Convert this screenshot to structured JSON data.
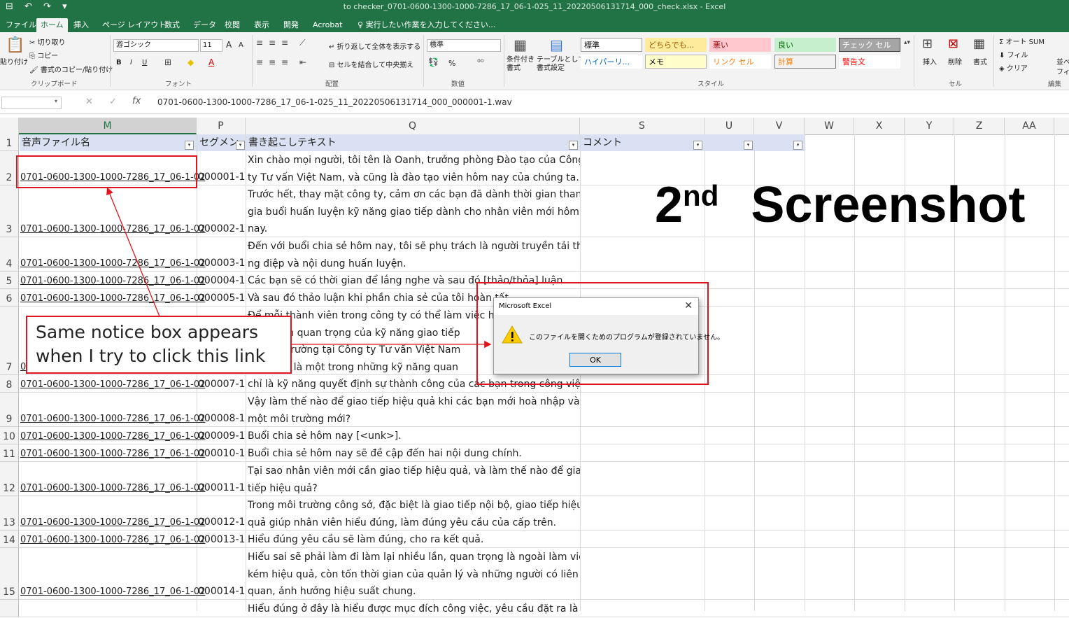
{
  "window": {
    "title": "to checker_0701-0600-1300-1000-7286_17_06-1-025_11_20220506131714_000_check.xlsx - Excel",
    "quick_access": "⊟ ↶ ↷ ▾"
  },
  "menu": {
    "tabs": [
      "ファイル",
      "ホーム",
      "挿入",
      "ページ レイアウト",
      "数式",
      "データ",
      "校閲",
      "表示",
      "開発",
      "Acrobat"
    ],
    "tell_me": "実行したい作業を入力してください..."
  },
  "ribbon": {
    "clipboard": {
      "paste": "貼り付け",
      "cut": "切り取り",
      "copy": "コピー",
      "format_painter": "書式のコピー/貼り付け",
      "label": "クリップボード"
    },
    "font": {
      "name": "游ゴシック",
      "size": "11",
      "label": "フォント",
      "grow": "A",
      "shrink": "A",
      "bold": "B",
      "italic": "I",
      "underline": "U"
    },
    "alignment": {
      "wrap": "折り返して全体を表示する",
      "merge": "セルを結合して中央揃え",
      "label": "配置"
    },
    "number": {
      "format": "標準",
      "label": "数値",
      "percent": "%"
    },
    "styles": {
      "conditional": "条件付き\n書式",
      "table": "テーブルとして\n書式設定",
      "cells": [
        {
          "text": "標準",
          "bg": "#ffffff",
          "fg": "#000000",
          "border": "#9a9a9a"
        },
        {
          "text": "どちらでも...",
          "bg": "#ffeb9c",
          "fg": "#9c5700",
          "border": "#ffeb9c"
        },
        {
          "text": "悪い",
          "bg": "#ffc7ce",
          "fg": "#9c0006",
          "border": "#ffc7ce"
        },
        {
          "text": "良い",
          "bg": "#c6efce",
          "fg": "#006100",
          "border": "#c6efce"
        },
        {
          "text": "チェック セル",
          "bg": "#a5a5a5",
          "fg": "#ffffff",
          "border": "#3f3f3f"
        },
        {
          "text": "ハイパーリ...",
          "bg": "#ffffff",
          "fg": "#0563c1",
          "border": "#ffffff"
        },
        {
          "text": "メモ",
          "bg": "#ffffcc",
          "fg": "#000000",
          "border": "#b2b2b2"
        },
        {
          "text": "リンク セル",
          "bg": "#ffffff",
          "fg": "#fa7d00",
          "border": "#ffffff"
        },
        {
          "text": "計算",
          "bg": "#f2f2f2",
          "fg": "#fa7d00",
          "border": "#7f7f7f"
        },
        {
          "text": "警告文",
          "bg": "#ffffff",
          "fg": "#ff0000",
          "border": "#ffffff"
        }
      ],
      "label": "スタイル"
    },
    "cells": {
      "insert": "挿入",
      "delete": "削除",
      "format": "書式",
      "label": "セル"
    },
    "editing": {
      "autosum": "オート SUM",
      "fill": "フィル",
      "clear": "クリア",
      "sort": "並べ",
      "filter": "フィ",
      "label": "編集"
    }
  },
  "formula_bar": {
    "value": "0701-0600-1300-1000-7286_17_06-1-025_11_20220506131714_000_000001-1.wav"
  },
  "columns": [
    "M",
    "P",
    "Q",
    "S",
    "U",
    "V",
    "W",
    "X",
    "Y",
    "Z",
    "AA"
  ],
  "header_row": {
    "M": "音声ファイル名",
    "P": "セグメン",
    "Q": "書き起こしテキスト",
    "S": "コメント"
  },
  "rows": [
    {
      "num": "2",
      "file": "0701-0600-1300-1000-7286_17_06-1-02",
      "seg": "000001-1",
      "text": [
        "Xin chào mọi người, tôi tên là Oanh, trưởng phòng Đào tạo của Công",
        "ty Tư vấn Việt Nam, và cũng là đào tạo viên hôm nay của chúng ta."
      ]
    },
    {
      "num": "3",
      "file": "0701-0600-1300-1000-7286_17_06-1-02",
      "seg": "000002-1",
      "text": [
        "Trước hết, thay mặt công ty, cảm ơn các bạn đã dành thời gian tham",
        "gia buổi huấn luyện kỹ năng giao tiếp dành cho nhân viên mới hôm",
        "nay."
      ]
    },
    {
      "num": "4",
      "file": "0701-0600-1300-1000-7286_17_06-1-02",
      "seg": "000003-1",
      "text": [
        "Đến với buổi chia sẻ hôm nay, tôi sẽ phụ trách là người truyền tải thô",
        "ng điệp và nội dung huấn luyện."
      ]
    },
    {
      "num": "5",
      "file": "0701-0600-1300-1000-7286_17_06-1-02",
      "seg": "000004-1",
      "text": [
        "Các bạn sẽ có thời gian để lắng nghe và sau đó [thảo/thỏa] luận."
      ]
    },
    {
      "num": "6",
      "file": "0701-0600-1300-1000-7286_17_06-1-02",
      "seg": "000005-1",
      "text": [
        "Và sau đó thảo luận khi phần chia sẻ của tôi hoàn tất."
      ]
    },
    {
      "num": "7",
      "file": "0701-0600-1300-1000-7286_17_06-1-02",
      "seg": "000006-1",
      "text": [
        "Để mỗi thành viên trong công ty có thể làm việc hiệu",
        "được tầm quan trọng của kỹ năng giao tiếp",
        "với môi trường tại Công ty Tư vấn Việt Nam",
        "giao tiếp là một trong những kỹ năng quan"
      ]
    },
    {
      "num": "8",
      "file": "0701-0600-1300-1000-7286_17_06-1-02",
      "seg": "000007-1",
      "text": [
        "chỉ là kỹ năng quyết định sự thành công của các bạn trong công việc."
      ]
    },
    {
      "num": "9",
      "file": "0701-0600-1300-1000-7286_17_06-1-02",
      "seg": "000008-1",
      "text": [
        "Vậy làm thế nào để giao tiếp hiệu quả khi các bạn mới hoà nhập vào",
        "một môi trường mới?"
      ]
    },
    {
      "num": "10",
      "file": "0701-0600-1300-1000-7286_17_06-1-02",
      "seg": "000009-1",
      "text": [
        "Buổi chia sẻ hôm nay [<unk>]."
      ]
    },
    {
      "num": "11",
      "file": "0701-0600-1300-1000-7286_17_06-1-02",
      "seg": "000010-1",
      "text": [
        "Buổi chia sẻ hôm nay sẽ đề cập đến hai nội dung chính."
      ]
    },
    {
      "num": "12",
      "file": "0701-0600-1300-1000-7286_17_06-1-02",
      "seg": "000011-1",
      "text": [
        "Tại sao nhân viên mới cần giao tiếp hiệu quả, và làm thế nào để giao",
        "tiếp hiệu quả?"
      ]
    },
    {
      "num": "13",
      "file": "0701-0600-1300-1000-7286_17_06-1-02",
      "seg": "000012-1",
      "text": [
        "Trong môi trường công sở, đặc biệt là giao tiếp nội bộ, giao tiếp hiệu",
        "quả giúp nhân viên hiểu đúng, làm đúng yêu cầu của cấp trên."
      ]
    },
    {
      "num": "14",
      "file": "0701-0600-1300-1000-7286_17_06-1-02",
      "seg": "000013-1",
      "text": [
        "Hiểu đúng yêu cầu sẽ làm đúng, cho ra kết quả."
      ]
    },
    {
      "num": "15",
      "file": "0701-0600-1300-1000-7286_17_06-1-02",
      "seg": "000014-1",
      "text": [
        "Hiểu sai sẽ phải làm đi làm lại nhiều lần, quan trọng là ngoài làm việc",
        "kém hiệu quả, còn tốn thời gian của quản lý và những người có liên",
        "quan, ảnh hưởng hiệu suất chung."
      ]
    },
    {
      "num": "",
      "file": "",
      "seg": "",
      "text": [
        "Hiểu đúng ở đây là hiểu được mục đích công việc, yêu cầu đặt ra là g"
      ]
    }
  ],
  "annotation": {
    "callout": "Same notice box appears\nwhen I try to click this link",
    "big_title": "2",
    "big_title_sup": "nd",
    "big_title_rest": "Screenshot"
  },
  "dialog": {
    "title": "Microsoft Excel",
    "message": "このファイルを開くためのプログラムが登録されていません。",
    "ok": "OK",
    "close": "✕"
  },
  "colors": {
    "excel_green": "#217346",
    "annotation_red": "#e0141e",
    "header_fill": "#d9e1f2"
  }
}
